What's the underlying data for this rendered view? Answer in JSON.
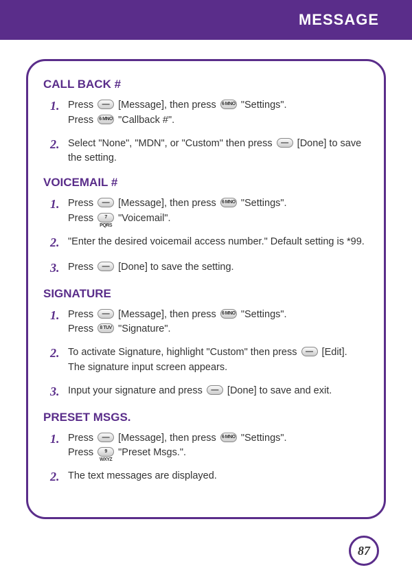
{
  "header": {
    "title": "MESSAGE"
  },
  "page_number": "87",
  "keys": {
    "dash": "—",
    "k6": "6 MNO",
    "k7": "7 PQRS",
    "k8": "8 TUV",
    "k9": "9 WXYZ"
  },
  "sections": {
    "callback": {
      "heading": "CALL BACK #",
      "step1n": "1.",
      "step1a": "Press ",
      "step1b": " [Message], then press ",
      "step1c": " \"Settings\".",
      "step1d": "Press ",
      "step1e": " \"Callback #\".",
      "step2n": "2.",
      "step2a": "Select \"None\", \"MDN\", or \"Custom\" then press ",
      "step2b": " [Done] to save the setting."
    },
    "voicemail": {
      "heading": "VOICEMAIL #",
      "step1n": "1.",
      "step1a": "Press ",
      "step1b": " [Message], then press ",
      "step1c": " \"Settings\".",
      "step1d": "Press ",
      "step1e": " \"Voicemail\".",
      "step2n": "2.",
      "step2": "\"Enter the desired voicemail access number.\" Default setting is *99.",
      "step3n": "3.",
      "step3a": "Press ",
      "step3b": " [Done] to save the setting."
    },
    "signature": {
      "heading": "SIGNATURE",
      "step1n": "1.",
      "step1a": "Press ",
      "step1b": " [Message], then press ",
      "step1c": " \"Settings\".",
      "step1d": "Press ",
      "step1e": " \"Signature\".",
      "step2n": "2.",
      "step2a": "To activate Signature, highlight \"Custom\" then press ",
      "step2b": " [Edit].",
      "step2c": "The signature input screen appears.",
      "step3n": "3.",
      "step3a": "Input your signature and press  ",
      "step3b": " [Done] to save and exit."
    },
    "preset": {
      "heading": "PRESET MSGS.",
      "step1n": "1.",
      "step1a": "Press ",
      "step1b": " [Message], then press ",
      "step1c": " \"Settings\".",
      "step1d": "Press  ",
      "step1e": " \"Preset Msgs.\".",
      "step2n": "2.",
      "step2": "The text messages are displayed."
    }
  }
}
